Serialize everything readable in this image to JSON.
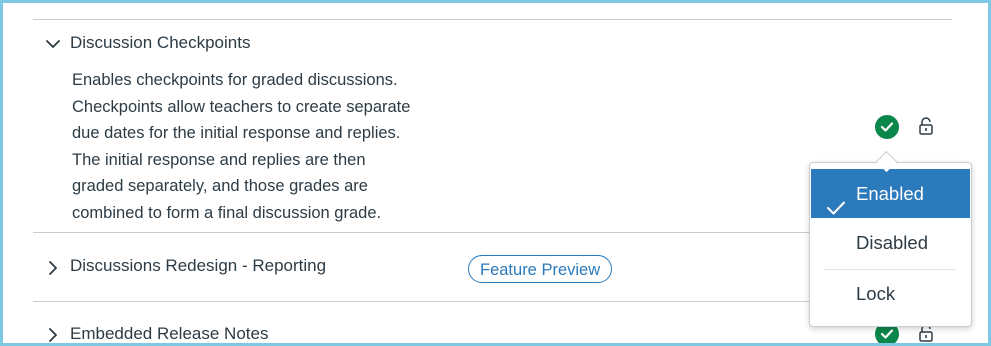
{
  "features": [
    {
      "title": "Discussion Checkpoints",
      "expanded": true,
      "description_lines": [
        "Enables checkpoints for graded discussions.",
        "Checkpoints allow teachers to create separate",
        "due dates for the initial response and replies.",
        "The initial response and replies are then",
        "graded separately, and those grades are",
        "combined to form a final discussion grade."
      ],
      "status": "enabled",
      "status_icon": "check-circle-icon",
      "lock_icon": "unlocked-icon"
    },
    {
      "title": "Discussions Redesign - Reporting",
      "expanded": false,
      "badge": "Feature Preview"
    },
    {
      "title": "Embedded Release Notes",
      "expanded": false,
      "status": "enabled",
      "status_icon": "check-circle-icon",
      "lock_icon": "unlocked-icon"
    }
  ],
  "state_menu": {
    "items": [
      {
        "label": "Enabled",
        "selected": true
      },
      {
        "label": "Disabled",
        "selected": false
      },
      {
        "label": "Lock",
        "selected": false
      }
    ]
  },
  "colors": {
    "accent": "#2b7abc",
    "success": "#0b874b",
    "text": "#2d3b45",
    "divider": "#c7cdd1",
    "frame": "#7ec8e3"
  }
}
